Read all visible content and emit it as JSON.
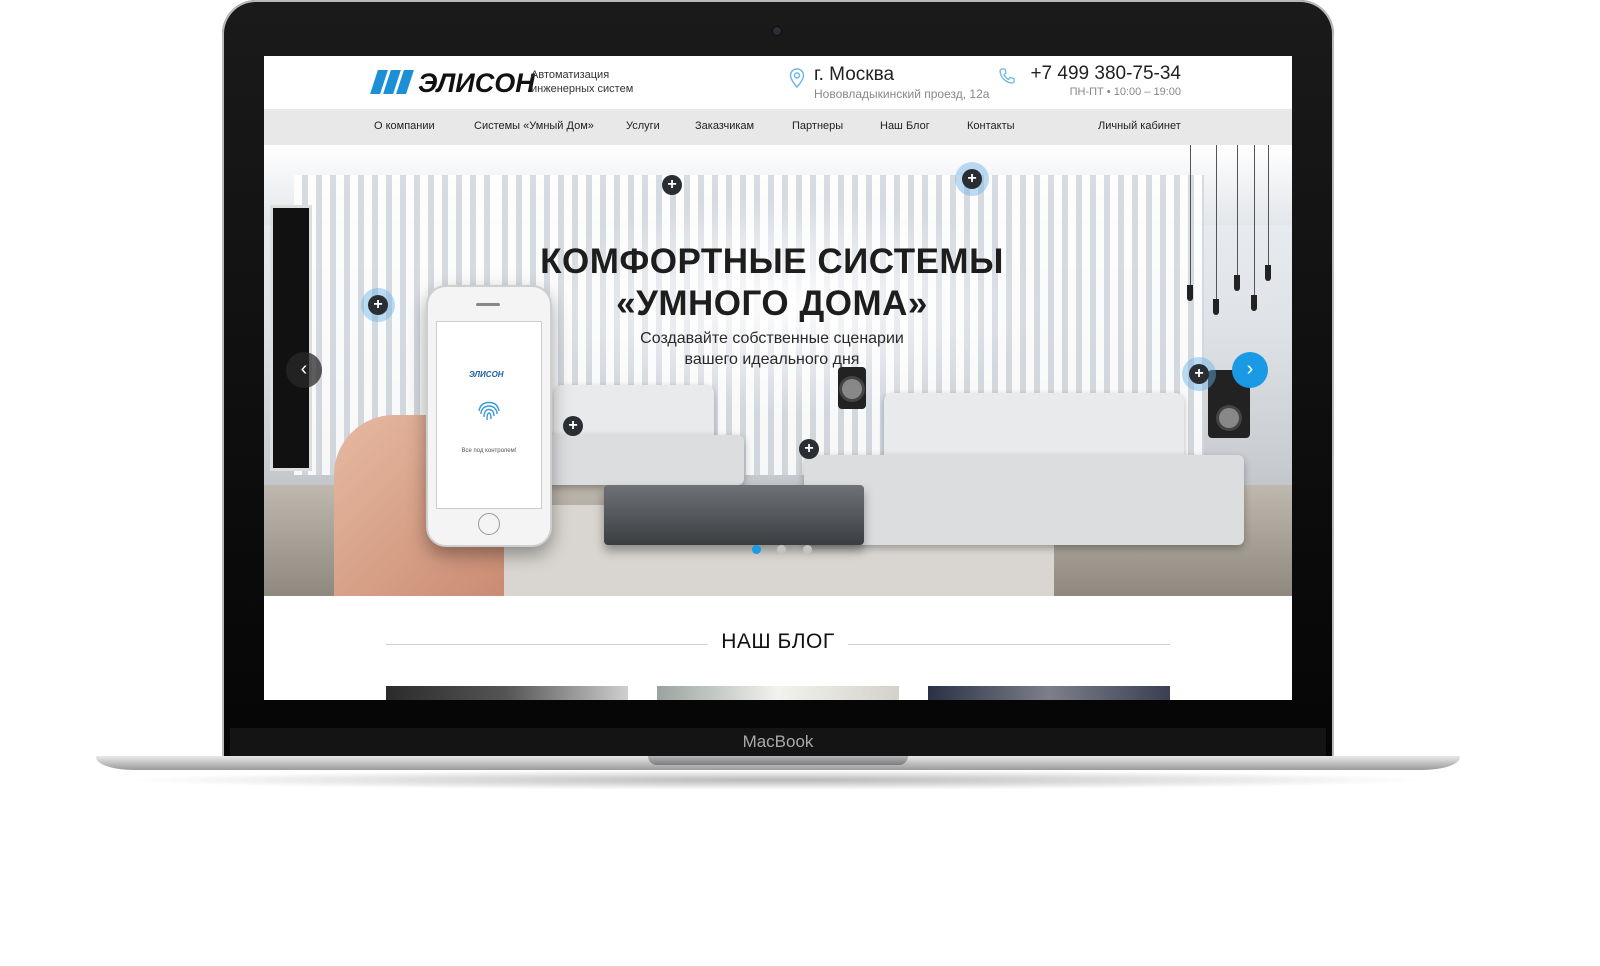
{
  "device": {
    "label": "MacBook"
  },
  "site": {
    "brand": "ЭЛИСОН",
    "tagline": "Автоматизация инженерных систем",
    "city": "г. Москва",
    "address": "Нововладыкинский проезд, 12а",
    "phone": "+7 499 380-75-34",
    "hours": "ПН-ПТ • 10:00 – 19:00",
    "nav": [
      "О компании",
      "Системы «Умный Дом»",
      "Услуги",
      "Заказчикам",
      "Партнеры",
      "Наш Блог",
      "Контакты"
    ],
    "account": "Личный кабинет"
  },
  "hero": {
    "title_line1": "КОМФОРТНЫЕ СИСТЕМЫ",
    "title_line2": "«УМНОГО ДОМА»",
    "subtitle_line1": "Создавайте собственные сценарии",
    "subtitle_line2": "вашего идеального дня",
    "phone_logo": "ЭЛИСОН",
    "phone_caption": "Все под контролем!",
    "hotspot_symbol": "+",
    "prev_symbol": "‹",
    "next_symbol": "›",
    "slides_total": 3,
    "active_slide": 1
  },
  "blog": {
    "title": "НАШ БЛОГ"
  },
  "colors": {
    "accent": "#1a9ae5",
    "nav_bg": "#e8e8e8",
    "logo_blue": "#1d8fd6"
  },
  "icons": {
    "location": "map-pin-icon",
    "phone": "phone-icon",
    "fingerprint": "fingerprint-icon"
  }
}
